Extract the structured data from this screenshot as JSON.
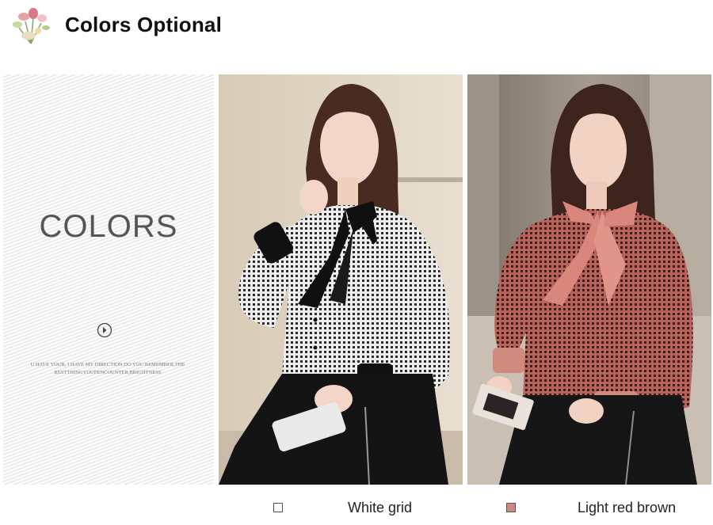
{
  "header": {
    "title": "Colors Optional",
    "logo_icon": "flower-bouquet-icon"
  },
  "intro_panel": {
    "heading": "COLORS",
    "arrow_icon": "circle-arrow-right-icon",
    "tagline_line1": "U HAVE YOUR, I HAVE MY DIRECTION,DO YOU REMEMBER,THE",
    "tagline_line2": "RESTTHINGYOUPENCOUNTER,BRIGHTNESS"
  },
  "products": [
    {
      "color_name": "White grid",
      "swatch_color": "#ffffff",
      "image": "model-white-grid-blouse-photo"
    },
    {
      "color_name": "Light red brown",
      "swatch_color": "#c98a86",
      "image": "model-light-red-brown-blouse-photo"
    }
  ]
}
